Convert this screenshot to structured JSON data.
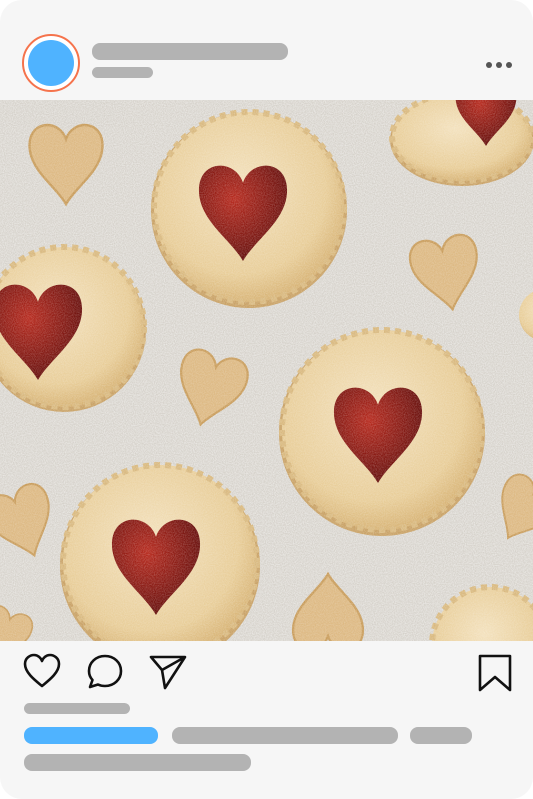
{
  "post": {
    "header": {
      "avatar_icon": "avatar-circle",
      "more_icon": "more-horizontal-icon"
    },
    "image": {
      "subject": "",
      "colors": {
        "background": "#d8d4ce",
        "cookie": "#e9cf9f",
        "jam": "#7a1410"
      }
    },
    "actions": {
      "icons": [
        "heart-icon",
        "comment-icon",
        "send-icon",
        "bookmark-icon"
      ]
    },
    "colors": {
      "accent": "#4fb3ff",
      "avatar_ring": "#f5734c",
      "skeleton": "#b3b3b3",
      "card_bg": "#f6f6f6"
    }
  }
}
